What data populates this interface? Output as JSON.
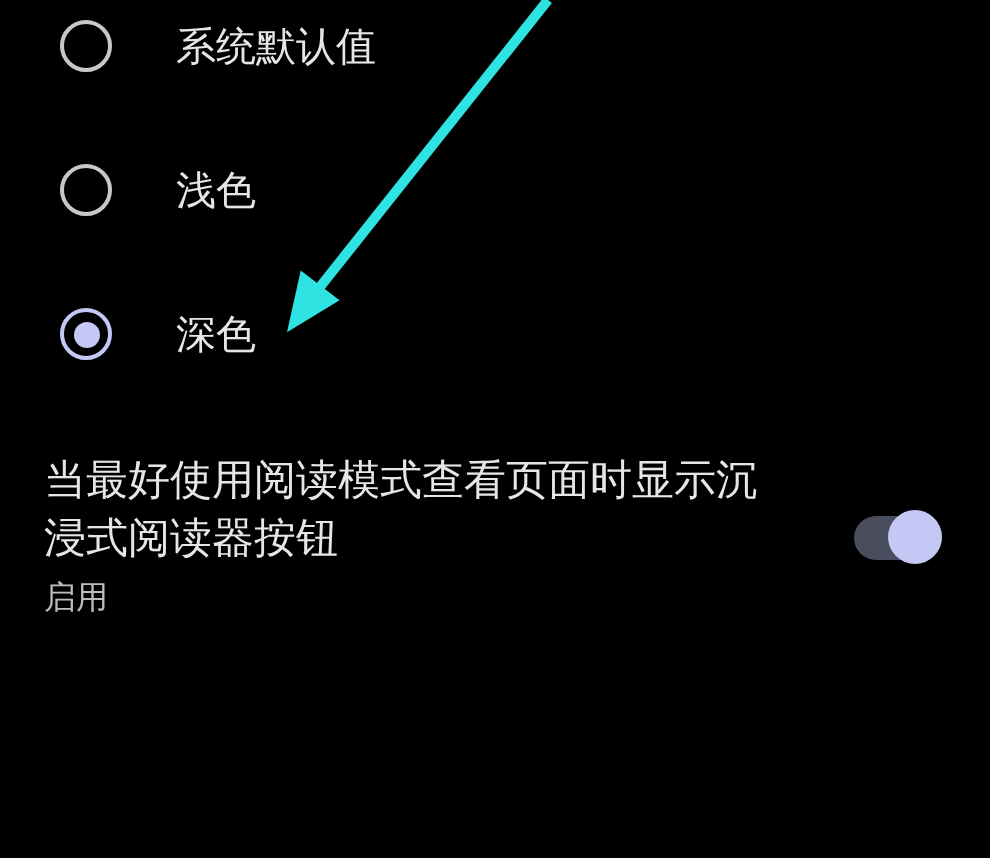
{
  "theme_options": [
    {
      "label": "系统默认值",
      "selected": false
    },
    {
      "label": "浅色",
      "selected": false
    },
    {
      "label": "深色",
      "selected": true
    }
  ],
  "reader_setting": {
    "title": "当最好使用阅读模式查看页面时显示沉浸式阅读器按钮",
    "status": "启用",
    "on": true
  }
}
